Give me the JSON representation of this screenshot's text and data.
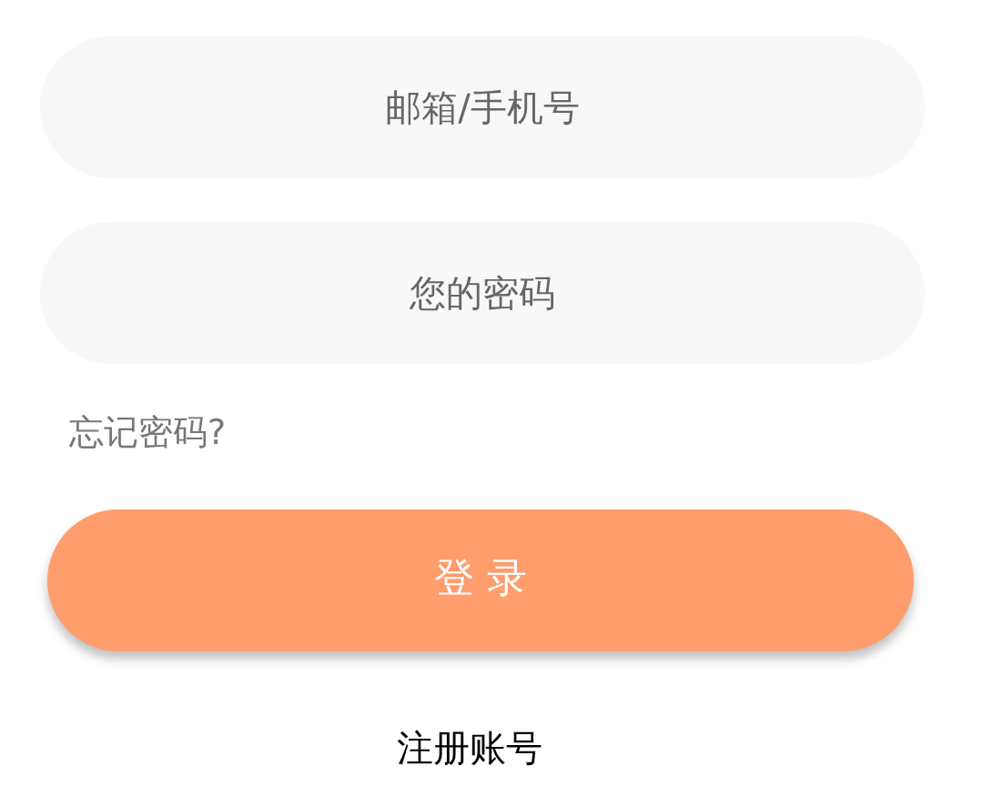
{
  "fields": [
    {
      "placeholder": "邮箱/手机号"
    },
    {
      "placeholder": "您的密码"
    }
  ],
  "forgot_link": "忘记密码?",
  "login_button": "登 录",
  "register_link": "注册账号"
}
